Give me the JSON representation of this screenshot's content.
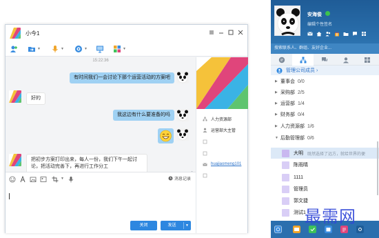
{
  "chat": {
    "title": "小今1",
    "timestamp": "15:22:36",
    "messages": {
      "m1": "有时间我们一会讨论下那个运营活动的方案吧",
      "m2": "好的",
      "m3": "我这边有什么要准备的吗",
      "m5": "把初步方案打印出来，每人一份，我们下午一起讨论，把活动完善下，再进行工作分工"
    },
    "history_label": "消息记录",
    "close_label": "关闭",
    "send_label": "发送",
    "side": {
      "dept": "人力资源部",
      "title": "运营部大主管",
      "email": "huajiaomeng101"
    }
  },
  "panel": {
    "user_name": "安海俊",
    "signature": "编辑个性签名",
    "search_placeholder": "搜索联系人、群组、友好企业...",
    "manage_label": "管理公司成员 ›",
    "departments": [
      {
        "name": "董事会",
        "count": "0/0"
      },
      {
        "name": "采购部",
        "count": "2/5"
      },
      {
        "name": "运营部",
        "count": "1/4"
      },
      {
        "name": "财务部",
        "count": "0/4"
      },
      {
        "name": "人力资源部",
        "count": "1/6"
      },
      {
        "name": "后勤管理部",
        "count": "0/6"
      }
    ],
    "members": [
      {
        "name": "大明",
        "sig": "既然选择了远方，就给世界的便"
      },
      {
        "name": "陈雨晴",
        "sig": ""
      },
      {
        "name": "1111",
        "sig": ""
      },
      {
        "name": "管理员",
        "sig": ""
      },
      {
        "name": "郭文捷",
        "sig": ""
      },
      {
        "name": "测试1",
        "sig": ""
      }
    ]
  },
  "watermark": "最需网",
  "colors": {
    "accent": "#2d87e0",
    "bubble_out": "#9fd1f3",
    "panel_head": "#2a6aa6"
  }
}
